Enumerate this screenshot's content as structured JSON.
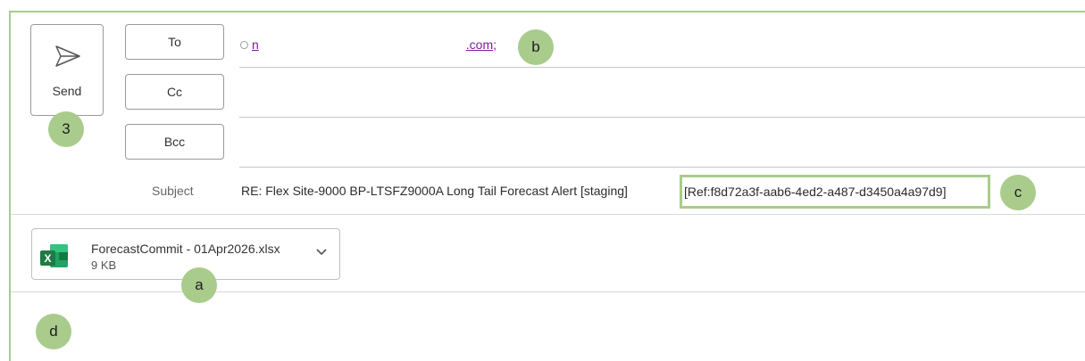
{
  "compose": {
    "send_label": "Send",
    "to_label": "To",
    "cc_label": "Cc",
    "bcc_label": "Bcc",
    "to_recipient_start": "n",
    "to_recipient_end": ".com",
    "to_separator": ";",
    "cc_value": "",
    "bcc_value": "",
    "subject_label": "Subject",
    "subject_main": "RE: Flex Site-9000 BP-LTSFZ9000A Long Tail Forecast Alert [staging]",
    "subject_ref": "[Ref:f8d72a3f-aab6-4ed2-a487-d3450a4a97d9]"
  },
  "attachment": {
    "filename": "ForecastCommit - 01Apr2026.xlsx",
    "size": "9 KB",
    "icon": "excel-file-icon"
  },
  "callouts": {
    "a": "a",
    "b": "b",
    "c": "c",
    "d": "d",
    "three": "3"
  },
  "colors": {
    "callout": "#a9cc8c",
    "frame": "#a9cc8c",
    "link": "#7a1d9c",
    "excel_green": "#1f7a45"
  }
}
